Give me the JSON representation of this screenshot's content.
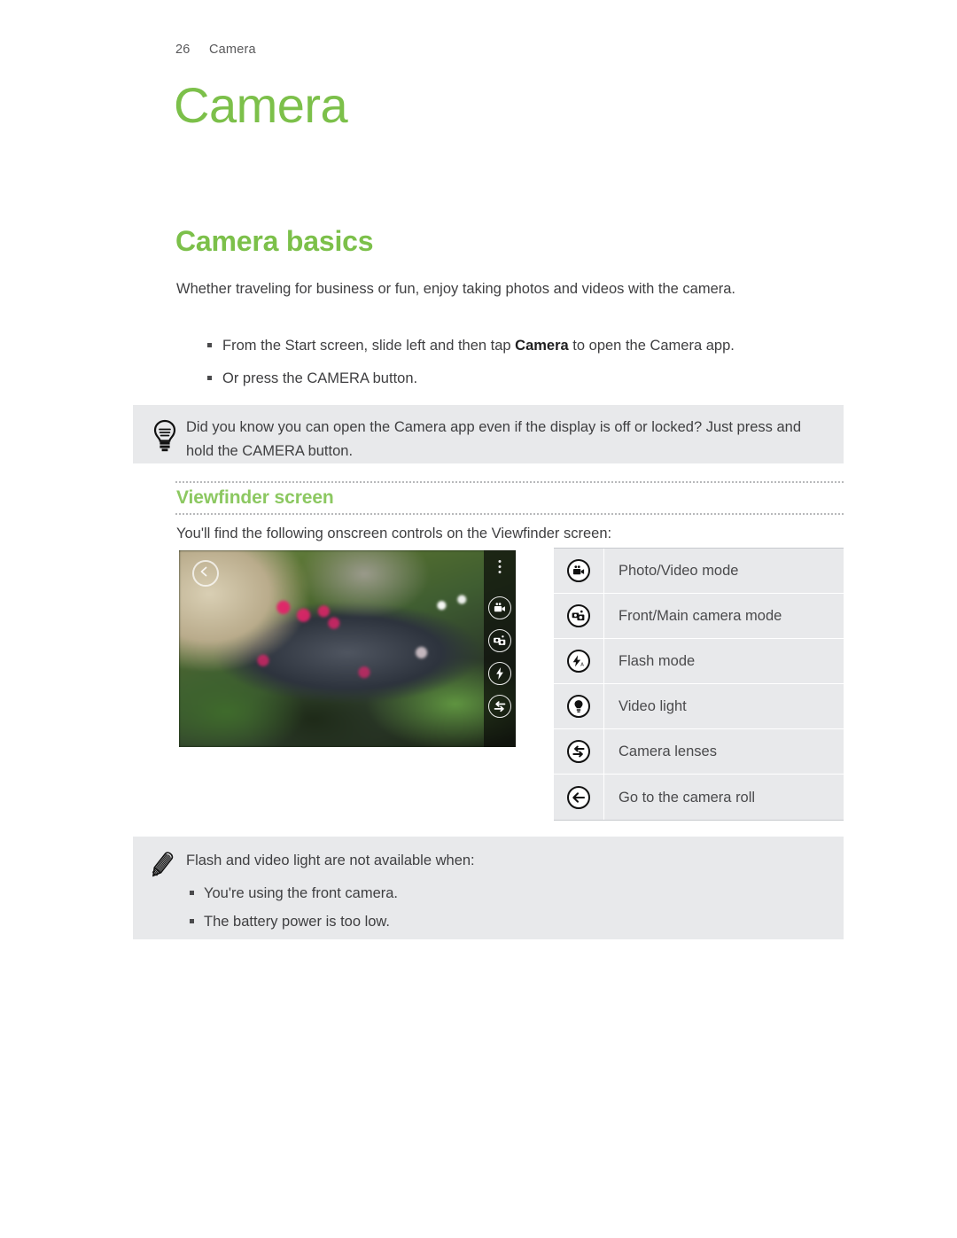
{
  "header": {
    "page_number": "26",
    "chapter": "Camera"
  },
  "chapter_title": "Camera",
  "sections": {
    "basics": {
      "heading": "Camera basics",
      "intro": "Whether traveling for business or fun, enjoy taking photos and videos with the camera.",
      "bullets": [
        {
          "pre": "From the Start screen, slide left and then tap ",
          "bold": "Camera",
          "post": " to open the Camera app."
        },
        {
          "pre": "Or press the CAMERA button.",
          "bold": "",
          "post": ""
        }
      ]
    },
    "viewfinder": {
      "heading": "Viewfinder screen",
      "lede": "You'll find the following onscreen controls on the Viewfinder screen:"
    }
  },
  "tip_callout": {
    "icon": "lightbulb-icon",
    "text": "Did you know you can open the Camera app even if the display is off or locked? Just press and hold the CAMERA button."
  },
  "note_callout": {
    "icon": "pencil-icon",
    "text": "Flash and video light are not available when:",
    "bullets": [
      "You're using the front camera.",
      "The battery power is too low."
    ]
  },
  "controls_table": {
    "rows": [
      {
        "icon": "video-camera-icon",
        "label": "Photo/Video mode"
      },
      {
        "icon": "front-main-camera-icon",
        "label": "Front/Main camera mode"
      },
      {
        "icon": "flash-auto-icon",
        "label": "Flash mode"
      },
      {
        "icon": "video-light-icon",
        "label": "Video light"
      },
      {
        "icon": "camera-lenses-icon",
        "label": "Camera lenses"
      },
      {
        "icon": "back-arrow-icon",
        "label": "Go to the camera roll"
      }
    ]
  },
  "viewfinder_screenshot": {
    "back_button_icon": "back-arrow-icon",
    "overflow_icon": "more-dots-icon",
    "sidebar_icons": [
      "video-camera-icon",
      "front-main-camera-icon",
      "flash-icon",
      "camera-lenses-icon"
    ]
  },
  "colors": {
    "accent_green": "#7cc04a",
    "subhead_green": "#8cc861",
    "callout_bg": "#e8e9eb",
    "body_text": "#3f3f41"
  }
}
